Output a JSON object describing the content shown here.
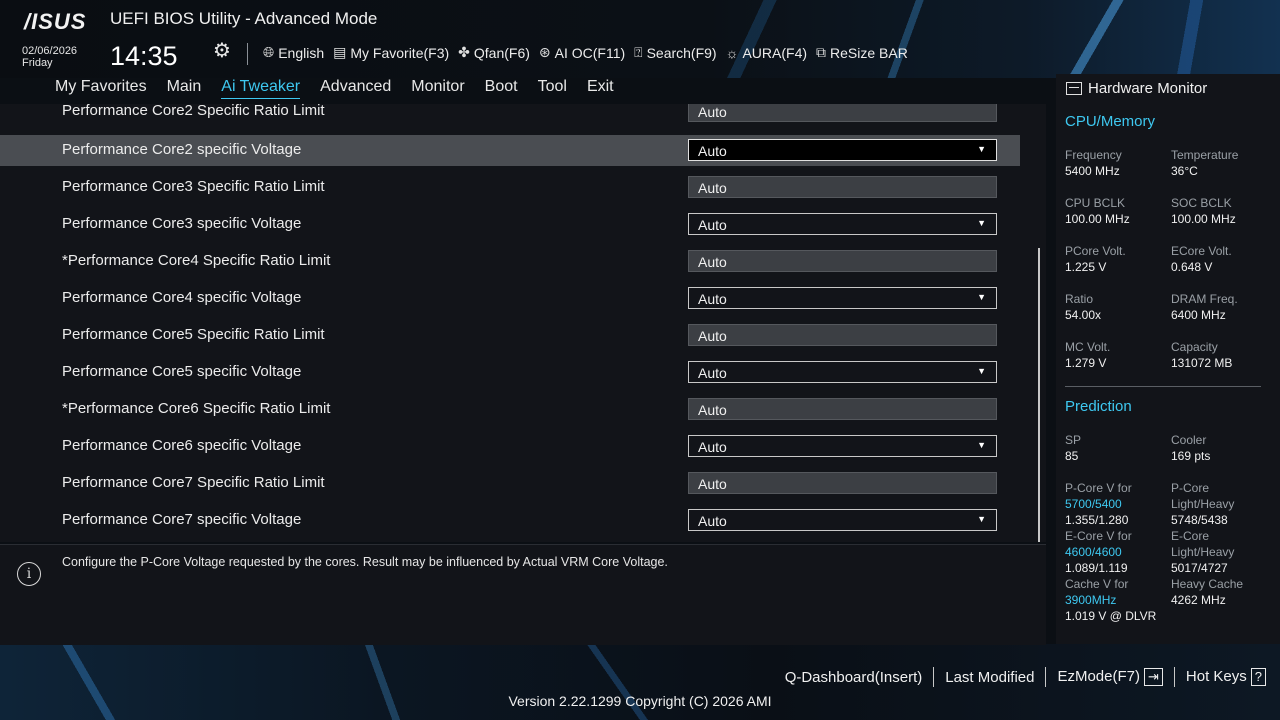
{
  "header": {
    "logo": "/ISUS",
    "title": "UEFI BIOS Utility - Advanced Mode",
    "date": "02/06/2026",
    "day": "Friday",
    "time": "14:35",
    "toolbar": [
      {
        "icon": "globe-icon",
        "label": "English"
      },
      {
        "icon": "favorite-list-icon",
        "label": "My Favorite(F3)"
      },
      {
        "icon": "fan-icon",
        "label": "Qfan(F6)"
      },
      {
        "icon": "ai-chip-icon",
        "label": "AI OC(F11)"
      },
      {
        "icon": "help-question-icon",
        "label": "Search(F9)"
      },
      {
        "icon": "aura-light-icon",
        "label": "AURA(F4)"
      },
      {
        "icon": "resize-bar-icon",
        "label": "ReSize BAR"
      }
    ]
  },
  "menu": {
    "tabs": [
      "My Favorites",
      "Main",
      "Ai Tweaker",
      "Advanced",
      "Monitor",
      "Boot",
      "Tool",
      "Exit"
    ],
    "active": "Ai Tweaker"
  },
  "settings": [
    {
      "label": "Performance Core2 Specific Ratio Limit",
      "value": "Auto",
      "kind": "ratio"
    },
    {
      "label": "Performance Core2 specific Voltage",
      "value": "Auto",
      "kind": "dropdown",
      "selected": true
    },
    {
      "label": "Performance Core3 Specific Ratio Limit",
      "value": "Auto",
      "kind": "ratio"
    },
    {
      "label": "Performance Core3 specific Voltage",
      "value": "Auto",
      "kind": "dropdown"
    },
    {
      "label": "*Performance Core4 Specific Ratio Limit",
      "value": "Auto",
      "kind": "ratio"
    },
    {
      "label": "Performance Core4 specific Voltage",
      "value": "Auto",
      "kind": "dropdown"
    },
    {
      "label": "Performance Core5 Specific Ratio Limit",
      "value": "Auto",
      "kind": "ratio"
    },
    {
      "label": "Performance Core5 specific Voltage",
      "value": "Auto",
      "kind": "dropdown"
    },
    {
      "label": "*Performance Core6 Specific Ratio Limit",
      "value": "Auto",
      "kind": "ratio"
    },
    {
      "label": "Performance Core6 specific Voltage",
      "value": "Auto",
      "kind": "dropdown"
    },
    {
      "label": "Performance Core7 Specific Ratio Limit",
      "value": "Auto",
      "kind": "ratio"
    },
    {
      "label": "Performance Core7 specific Voltage",
      "value": "Auto",
      "kind": "dropdown"
    }
  ],
  "help_text": "Configure the P-Core Voltage requested by the cores. Result may be influenced by Actual VRM Core Voltage.",
  "hardware_monitor": {
    "title": "Hardware Monitor",
    "cpu_memory": {
      "heading": "CPU/Memory",
      "frequency": {
        "label": "Frequency",
        "value": "5400 MHz"
      },
      "temperature": {
        "label": "Temperature",
        "value": "36°C"
      },
      "cpu_bclk": {
        "label": "CPU BCLK",
        "value": "100.00 MHz"
      },
      "soc_bclk": {
        "label": "SOC BCLK",
        "value": "100.00 MHz"
      },
      "pcore_volt": {
        "label": "PCore Volt.",
        "value": "1.225 V"
      },
      "ecore_volt": {
        "label": "ECore Volt.",
        "value": "0.648 V"
      },
      "ratio": {
        "label": "Ratio",
        "value": "54.00x"
      },
      "dram_freq": {
        "label": "DRAM Freq.",
        "value": "6400 MHz"
      },
      "mc_volt": {
        "label": "MC Volt.",
        "value": "1.279 V"
      },
      "capacity": {
        "label": "Capacity",
        "value": "131072 MB"
      }
    },
    "prediction": {
      "heading": "Prediction",
      "sp": {
        "label": "SP",
        "value": "85"
      },
      "cooler": {
        "label": "Cooler",
        "value": "169 pts"
      },
      "pcore_v_for": {
        "label": "P-Core V for",
        "freq": "5700/5400",
        "value": "1.355/1.280"
      },
      "pcore_lh": {
        "label1": "P-Core",
        "label2": "Light/Heavy",
        "value": "5748/5438"
      },
      "ecore_v_for": {
        "label": "E-Core V for",
        "freq": "4600/4600",
        "value": "1.089/1.119"
      },
      "ecore_lh": {
        "label1": "E-Core",
        "label2": "Light/Heavy",
        "value": "5017/4727"
      },
      "cache_v_for": {
        "label": "Cache V for",
        "freq": "3900MHz",
        "value": "1.019 V @ DLVR"
      },
      "heavy_cache": {
        "label": "Heavy Cache",
        "value": "4262 MHz"
      }
    }
  },
  "footer": {
    "qdashboard": "Q-Dashboard(Insert)",
    "last_modified": "Last Modified",
    "ezmode": "EzMode(F7)",
    "hotkeys": "Hot Keys",
    "version": "Version 2.22.1299 Copyright (C) 2026 AMI"
  }
}
